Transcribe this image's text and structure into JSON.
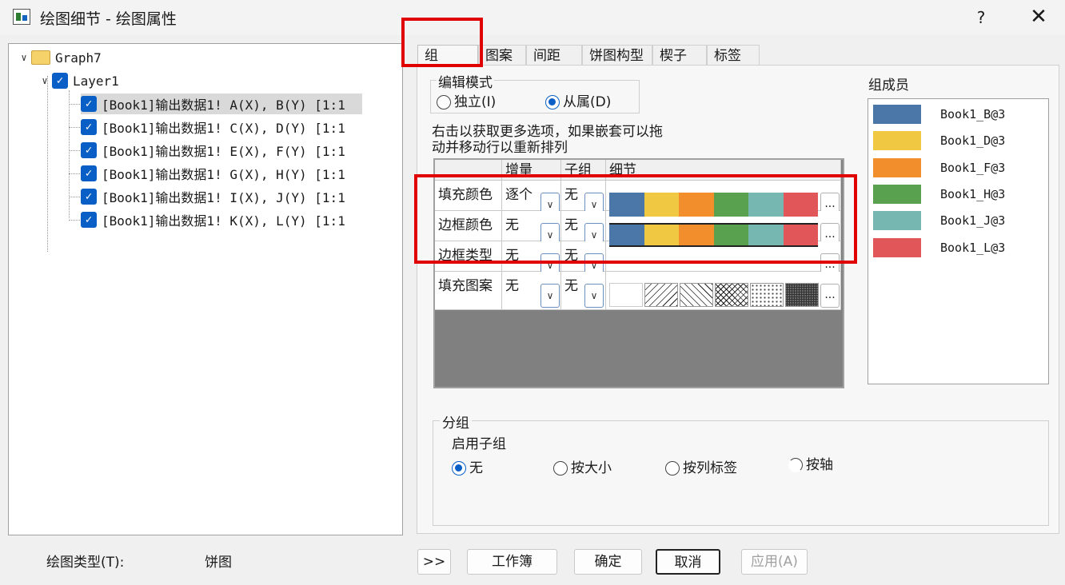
{
  "window": {
    "title": "绘图细节 - 绘图属性",
    "help_label": "?",
    "close_label": "✕"
  },
  "tree": {
    "root": "Graph7",
    "layer": "Layer1",
    "items": [
      "[Book1]输出数据1! A(X), B(Y) [1:1",
      "[Book1]输出数据1! C(X), D(Y) [1:1",
      "[Book1]输出数据1! E(X), F(Y) [1:1",
      "[Book1]输出数据1! G(X), H(Y) [1:1",
      "[Book1]输出数据1! I(X), J(Y) [1:1",
      "[Book1]输出数据1! K(X), L(Y) [1:1"
    ]
  },
  "plot_type": {
    "label": "绘图类型(T):",
    "value": "饼图"
  },
  "tabs": [
    "组",
    "图案",
    "间距",
    "饼图构型",
    "楔子",
    "标签"
  ],
  "edit_mode": {
    "title": "编辑模式",
    "options": [
      "独立(I)",
      "从属(D)"
    ],
    "selected": "从属(D)"
  },
  "hint": {
    "line1": "右击以获取更多选项，如果嵌套可以拖",
    "line2": "动并移动行以重新排列"
  },
  "grid": {
    "headers": [
      "增量",
      "子组",
      "细节"
    ],
    "rows": [
      {
        "name": "填充颜色",
        "increment": "逐个",
        "subgroup": "无"
      },
      {
        "name": "边框颜色",
        "increment": "无",
        "subgroup": "无"
      },
      {
        "name": "边框类型",
        "increment": "无",
        "subgroup": "无"
      },
      {
        "name": "填充图案",
        "increment": "无",
        "subgroup": "无"
      }
    ],
    "more_label": "..."
  },
  "palette": [
    "#4a76a8",
    "#f0c842",
    "#f28e2b",
    "#59a14f",
    "#76b7b2",
    "#e15759"
  ],
  "members": {
    "title": "组成员",
    "items": [
      "Book1_B@3",
      "Book1_D@3",
      "Book1_F@3",
      "Book1_H@3",
      "Book1_J@3",
      "Book1_L@3"
    ]
  },
  "grouping": {
    "title": "分组",
    "subgroup_label": "启用子组",
    "options": [
      "无",
      "按大小",
      "按列标签",
      "按轴"
    ],
    "selected": "无"
  },
  "buttons": {
    "expand": ">>",
    "workbook": "工作簿",
    "ok": "确定",
    "cancel": "取消",
    "apply": "应用(A)"
  }
}
